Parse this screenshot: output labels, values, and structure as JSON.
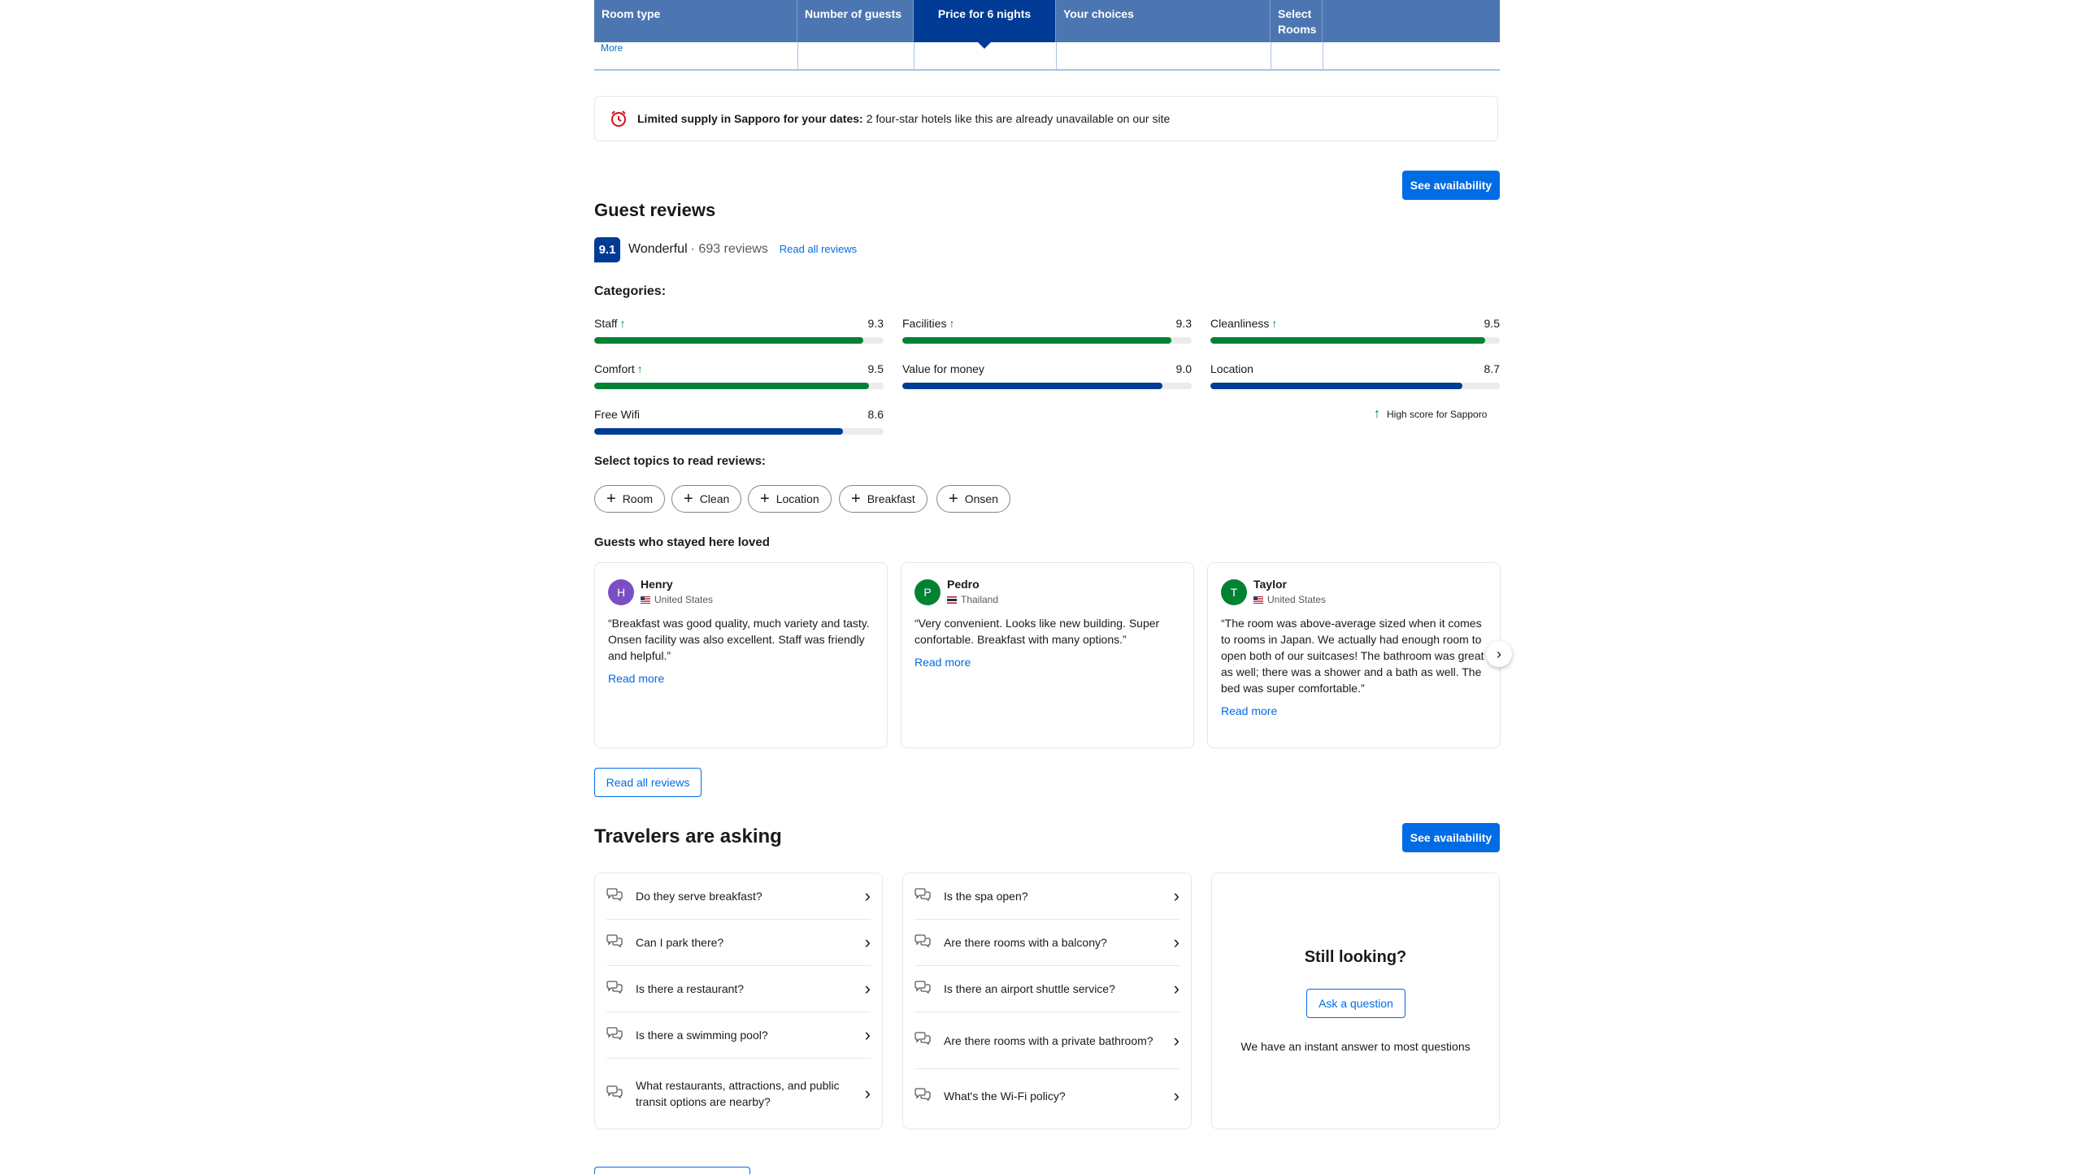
{
  "room_table": {
    "headers": [
      "Room type",
      "Number of guests",
      "Price for 6 nights",
      "Your choices",
      "Select Rooms"
    ],
    "more_link": "More"
  },
  "limited_supply": {
    "bold": "Limited supply in Sapporo for your dates:",
    "text": "2 four-star hotels like this are already unavailable on our site"
  },
  "see_availability_label": "See availability",
  "guest_reviews": {
    "title": "Guest reviews",
    "score": "9.1",
    "rating_word": "Wonderful",
    "review_count": "· 693 reviews",
    "read_all_link": "Read all reviews",
    "categories_title": "Categories:",
    "categories": [
      {
        "name": "Staff",
        "score": "9.3",
        "high": true,
        "value": 9.3
      },
      {
        "name": "Facilities",
        "score": "9.3",
        "high": true,
        "value": 9.3
      },
      {
        "name": "Cleanliness",
        "score": "9.5",
        "high": true,
        "value": 9.5
      },
      {
        "name": "Comfort",
        "score": "9.5",
        "high": true,
        "value": 9.5
      },
      {
        "name": "Value for money",
        "score": "9.0",
        "high": false,
        "value": 9.0
      },
      {
        "name": "Location",
        "score": "8.7",
        "high": false,
        "value": 8.7
      },
      {
        "name": "Free Wifi",
        "score": "8.6",
        "high": false,
        "value": 8.6
      }
    ],
    "high_score_note": "High score for Sapporo",
    "topics_title": "Select topics to read reviews:",
    "topics": [
      "Room",
      "Clean",
      "Location",
      "Breakfast",
      "Onsen"
    ],
    "loved_title": "Guests who stayed here loved",
    "reviews": [
      {
        "initial": "H",
        "name": "Henry",
        "country": "United States",
        "avatar_color": "#7b4fc4",
        "text": "“Breakfast was good quality, much variety and tasty. Onsen facility was also excellent. Staff was friendly and helpful.”",
        "more": "Read more"
      },
      {
        "initial": "P",
        "name": "Pedro",
        "country": "Thailand",
        "avatar_color": "#008234",
        "text": "“Very convenient. Looks like new building. Super confortable. Breakfast with many options.”",
        "more": "Read more"
      },
      {
        "initial": "T",
        "name": "Taylor",
        "country": "United States",
        "avatar_color": "#008234",
        "text": "“The room was above-average sized when it comes to rooms in Japan. We actually had enough room to open both of our suitcases! The bathroom was great as well; there was a shower and a bath as well. The bed was super comfortable.”",
        "more": "Read more"
      }
    ],
    "read_all_button": "Read all reviews"
  },
  "travelers_asking": {
    "title": "Travelers are asking",
    "left_questions": [
      "Do they serve breakfast?",
      "Can I park there?",
      "Is there a restaurant?",
      "Is there a swimming pool?",
      "What restaurants, attractions, and public transit options are nearby?"
    ],
    "right_questions": [
      "Is the spa open?",
      "Are there rooms with a balcony?",
      "Is there an airport shuttle service?",
      "Are there rooms with a private bathroom?",
      "What's the Wi-Fi policy?"
    ],
    "still_looking": "Still looking?",
    "ask_button": "Ask a question",
    "instant_answer": "We have an instant answer to most questions"
  },
  "colors": {
    "header_blue": "#4c76b2",
    "active_blue": "#003b95",
    "green_bar": "#008234",
    "blue_bar": "#003b95",
    "link_blue": "#006ce4"
  }
}
